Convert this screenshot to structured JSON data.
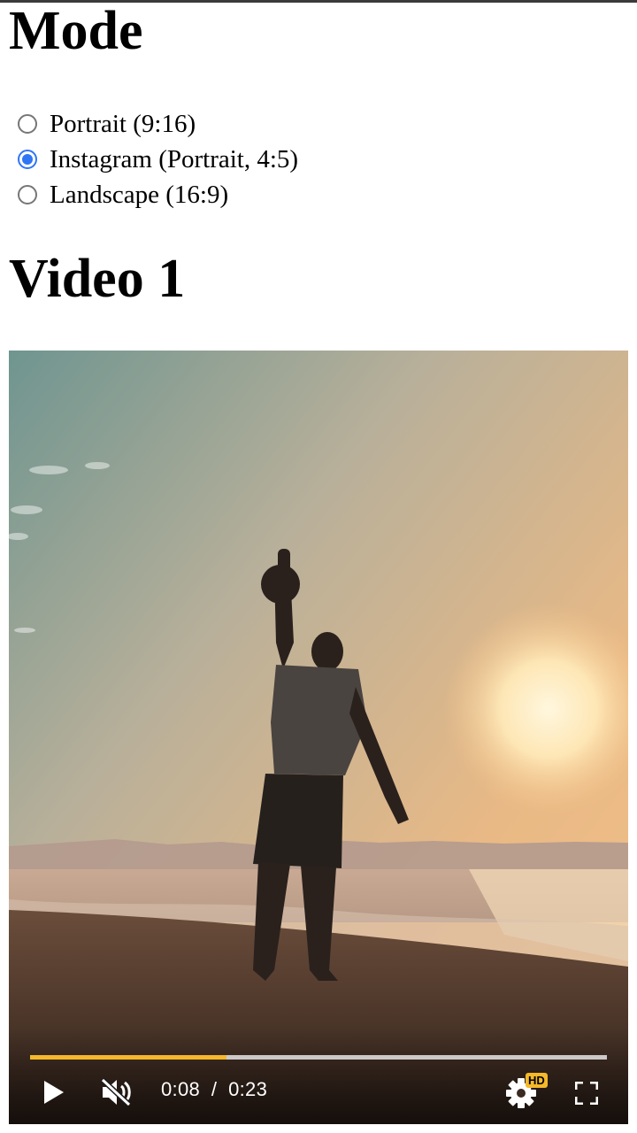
{
  "mode_section": {
    "title": "Mode",
    "options": [
      {
        "label": "Portrait (9:16)",
        "checked": false
      },
      {
        "label": "Instagram (Portrait, 4:5)",
        "checked": true
      },
      {
        "label": "Landscape (16:9)",
        "checked": false
      }
    ]
  },
  "video_section": {
    "title": "Video 1",
    "player": {
      "current_time": "0:08",
      "time_separator": "/",
      "duration": "0:23",
      "progress_fraction": 0.34,
      "hd_badge": "HD",
      "muted": true,
      "playing": false,
      "accent_color": "#f5b82a"
    }
  },
  "colors": {
    "radio_checked": "#2f76f5",
    "progress_fill": "#f5b82a"
  }
}
